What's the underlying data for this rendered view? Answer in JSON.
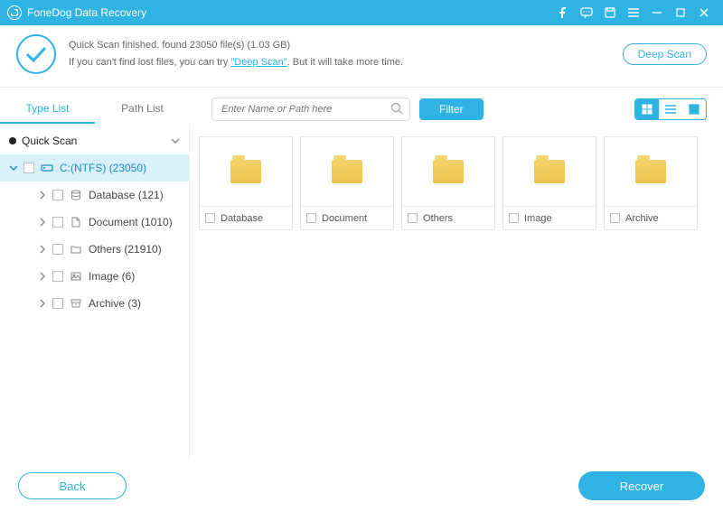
{
  "titlebar": {
    "app_name": "FoneDog Data Recovery"
  },
  "info": {
    "line1": "Quick Scan finished, found 23050 file(s) (1.03 GB)",
    "line2_a": "If you can't find lost files, you can try ",
    "line2_link": "\"Deep Scan\"",
    "line2_b": ". But it will take more time.",
    "deep_scan_btn": "Deep Scan"
  },
  "tabs": {
    "type": "Type List",
    "path": "Path List"
  },
  "search": {
    "placeholder": "Enter Name or Path here"
  },
  "filter_btn": "Filter",
  "tree": {
    "root": "Quick Scan",
    "drive": "C:(NTFS) (23050)",
    "children": [
      {
        "label": "Database (121)"
      },
      {
        "label": "Document (1010)"
      },
      {
        "label": "Others (21910)"
      },
      {
        "label": "Image (6)"
      },
      {
        "label": "Archive (3)"
      }
    ]
  },
  "grid": [
    {
      "label": "Database"
    },
    {
      "label": "Document"
    },
    {
      "label": "Others"
    },
    {
      "label": "Image"
    },
    {
      "label": "Archive"
    }
  ],
  "footer": {
    "back": "Back",
    "recover": "Recover"
  }
}
